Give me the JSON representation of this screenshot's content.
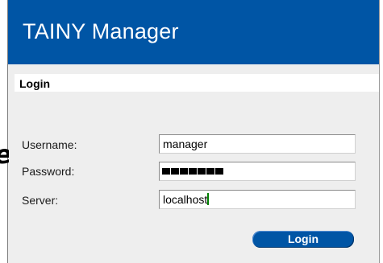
{
  "app": {
    "title": "TAINY Manager"
  },
  "login_section": {
    "title": "Login"
  },
  "fields": {
    "username": {
      "label": "Username:",
      "value": "manager"
    },
    "password": {
      "label": "Password:",
      "masked_length": 7
    },
    "server": {
      "label": "Server:",
      "value": "localhost"
    }
  },
  "actions": {
    "login_label": "Login"
  },
  "background_fragment": {
    "text": "e"
  },
  "colors": {
    "brand_blue": "#0055a5",
    "panel": "#eeeeee",
    "caret": "#008000"
  }
}
